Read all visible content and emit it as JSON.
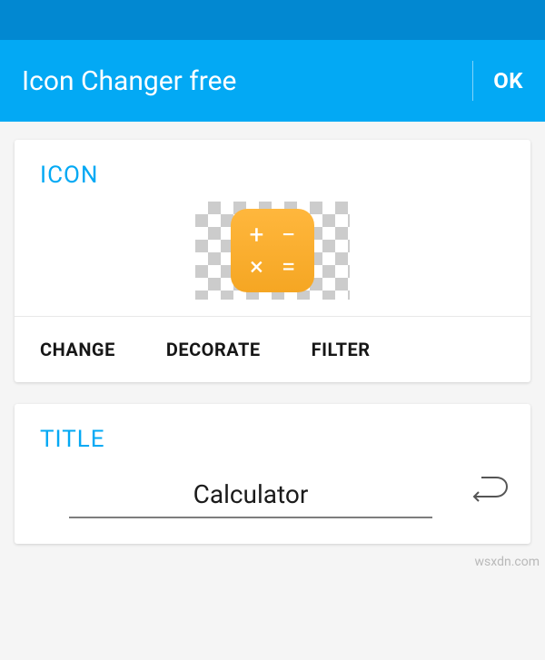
{
  "header": {
    "title": "Icon Changer free",
    "ok_label": "OK"
  },
  "icon_card": {
    "section_label": "ICON",
    "preview_icon": "calculator-icon",
    "tabs": [
      {
        "label": "CHANGE"
      },
      {
        "label": "DECORATE"
      },
      {
        "label": "FILTER"
      }
    ]
  },
  "title_card": {
    "section_label": "TITLE",
    "input_value": "Calculator"
  },
  "watermark": "wsxdn.com"
}
